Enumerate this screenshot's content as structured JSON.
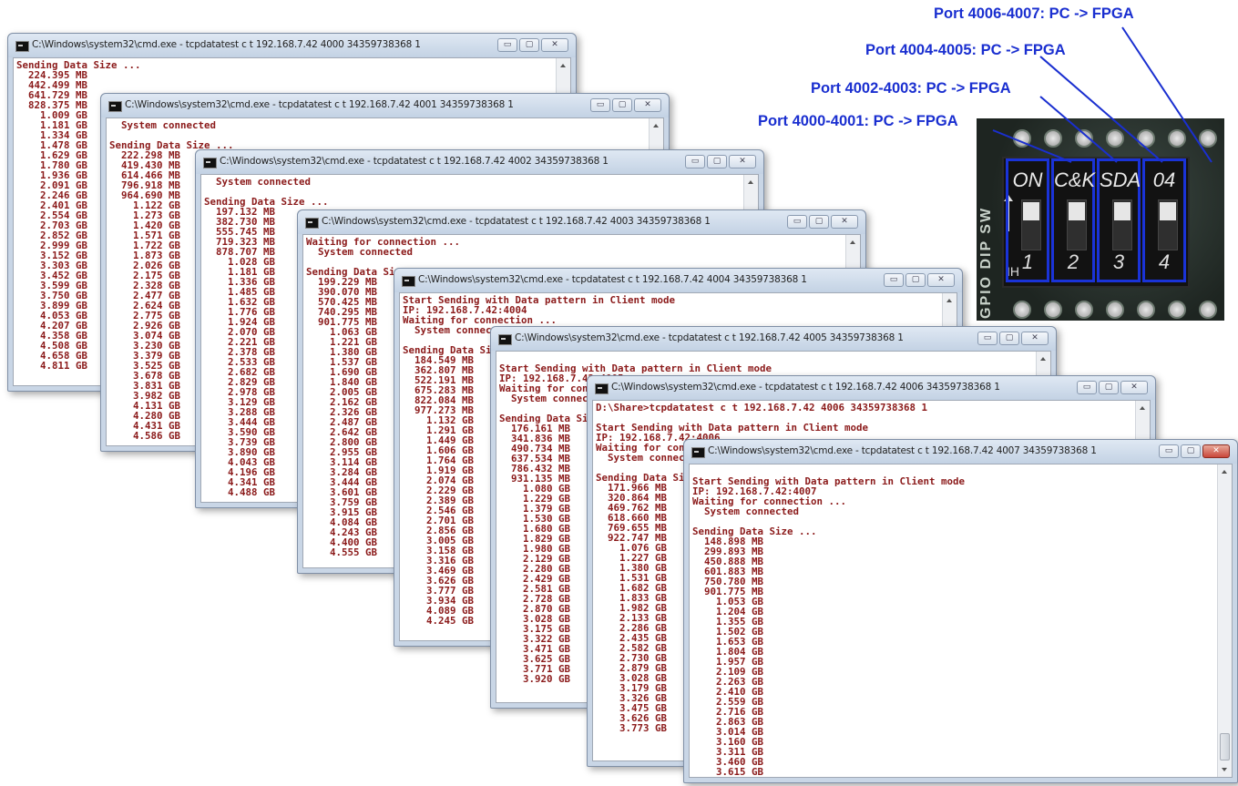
{
  "windows": [
    {
      "title": "C:\\Windows\\system32\\cmd.exe - tcpdatatest c t 192.168.7.42 4000 34359738368 1",
      "lines": [
        "Sending Data Size ...",
        "  224.395 MB",
        "  442.499 MB",
        "  641.729 MB",
        "  828.375 MB",
        "    1.009 GB",
        "    1.181 GB",
        "    1.334 GB",
        "    1.478 GB",
        "    1.629 GB",
        "    1.780 GB",
        "    1.936 GB",
        "    2.091 GB",
        "    2.246 GB",
        "    2.401 GB",
        "    2.554 GB",
        "    2.703 GB",
        "    2.852 GB",
        "    2.999 GB",
        "    3.152 GB",
        "    3.303 GB",
        "    3.452 GB",
        "    3.599 GB",
        "    3.750 GB",
        "    3.899 GB",
        "    4.053 GB",
        "    4.207 GB",
        "    4.358 GB",
        "    4.508 GB",
        "    4.658 GB",
        "    4.811 GB"
      ]
    },
    {
      "title": "C:\\Windows\\system32\\cmd.exe - tcpdatatest c t 192.168.7.42 4001 34359738368 1",
      "lines": [
        "  System connected",
        "",
        "Sending Data Size ...",
        "  222.298 MB",
        "  419.430 MB",
        "  614.466 MB",
        "  796.918 MB",
        "  964.690 MB",
        "    1.122 GB",
        "    1.273 GB",
        "    1.420 GB",
        "    1.571 GB",
        "    1.722 GB",
        "    1.873 GB",
        "    2.026 GB",
        "    2.175 GB",
        "    2.328 GB",
        "    2.477 GB",
        "    2.624 GB",
        "    2.775 GB",
        "    2.926 GB",
        "    3.074 GB",
        "    3.230 GB",
        "    3.379 GB",
        "    3.525 GB",
        "    3.678 GB",
        "    3.831 GB",
        "    3.982 GB",
        "    4.131 GB",
        "    4.280 GB",
        "    4.431 GB",
        "    4.586 GB"
      ]
    },
    {
      "title": "C:\\Windows\\system32\\cmd.exe - tcpdatatest c t 192.168.7.42 4002 34359738368 1",
      "lines": [
        "  System connected",
        "",
        "Sending Data Size ...",
        "  197.132 MB",
        "  382.730 MB",
        "  555.745 MB",
        "  719.323 MB",
        "  878.707 MB",
        "    1.028 GB",
        "    1.181 GB",
        "    1.336 GB",
        "    1.485 GB",
        "    1.632 GB",
        "    1.776 GB",
        "    1.924 GB",
        "    2.070 GB",
        "    2.221 GB",
        "    2.378 GB",
        "    2.533 GB",
        "    2.682 GB",
        "    2.829 GB",
        "    2.978 GB",
        "    3.129 GB",
        "    3.288 GB",
        "    3.444 GB",
        "    3.590 GB",
        "    3.739 GB",
        "    3.890 GB",
        "    4.043 GB",
        "    4.196 GB",
        "    4.341 GB",
        "    4.488 GB"
      ]
    },
    {
      "title": "C:\\Windows\\system32\\cmd.exe - tcpdatatest c t 192.168.7.42 4003 34359738368 1",
      "lines": [
        "Waiting for connection ...",
        "  System connected",
        "",
        "Sending Data Size ...",
        "  199.229 MB",
        "  390.070 MB",
        "  570.425 MB",
        "  740.295 MB",
        "  901.775 MB",
        "    1.063 GB",
        "    1.221 GB",
        "    1.380 GB",
        "    1.537 GB",
        "    1.690 GB",
        "    1.840 GB",
        "    2.005 GB",
        "    2.162 GB",
        "    2.326 GB",
        "    2.487 GB",
        "    2.642 GB",
        "    2.800 GB",
        "    2.955 GB",
        "    3.114 GB",
        "    3.284 GB",
        "    3.444 GB",
        "    3.601 GB",
        "    3.759 GB",
        "    3.915 GB",
        "    4.084 GB",
        "    4.243 GB",
        "    4.400 GB",
        "    4.555 GB"
      ]
    },
    {
      "title": "C:\\Windows\\system32\\cmd.exe - tcpdatatest c t 192.168.7.42 4004 34359738368 1",
      "lines": [
        "Start Sending with Data pattern in Client mode",
        "IP: 192.168.7.42:4004",
        "Waiting for connection ...",
        "  System connected",
        "",
        "Sending Data Size ...",
        "  184.549 MB",
        "  362.807 MB",
        "  522.191 MB",
        "  675.283 MB",
        "  822.084 MB",
        "  977.273 MB",
        "    1.132 GB",
        "    1.291 GB",
        "    1.449 GB",
        "    1.606 GB",
        "    1.764 GB",
        "    1.919 GB",
        "    2.074 GB",
        "    2.229 GB",
        "    2.389 GB",
        "    2.546 GB",
        "    2.701 GB",
        "    2.856 GB",
        "    3.005 GB",
        "    3.158 GB",
        "    3.316 GB",
        "    3.469 GB",
        "    3.626 GB",
        "    3.777 GB",
        "    3.934 GB",
        "    4.089 GB",
        "    4.245 GB"
      ]
    },
    {
      "title": "C:\\Windows\\system32\\cmd.exe - tcpdatatest c t 192.168.7.42 4005 34359738368 1",
      "lines": [
        "",
        "Start Sending with Data pattern in Client mode",
        "IP: 192.168.7.42:4005",
        "Waiting for connection ...",
        "  System connected",
        "",
        "Sending Data Size ...",
        "  176.161 MB",
        "  341.836 MB",
        "  490.734 MB",
        "  637.534 MB",
        "  786.432 MB",
        "  931.135 MB",
        "    1.080 GB",
        "    1.229 GB",
        "    1.379 GB",
        "    1.530 GB",
        "    1.680 GB",
        "    1.829 GB",
        "    1.980 GB",
        "    2.129 GB",
        "    2.280 GB",
        "    2.429 GB",
        "    2.581 GB",
        "    2.728 GB",
        "    2.870 GB",
        "    3.028 GB",
        "    3.175 GB",
        "    3.322 GB",
        "    3.471 GB",
        "    3.625 GB",
        "    3.771 GB",
        "    3.920 GB"
      ]
    },
    {
      "title": "C:\\Windows\\system32\\cmd.exe - tcpdatatest c t 192.168.7.42 4006 34359738368 1",
      "lines": [
        "D:\\Share>tcpdatatest c t 192.168.7.42 4006 34359738368 1",
        "",
        "Start Sending with Data pattern in Client mode",
        "IP: 192.168.7.42:4006",
        "Waiting for connection ...",
        "  System connected",
        "",
        "Sending Data Size ...",
        "  171.966 MB",
        "  320.864 MB",
        "  469.762 MB",
        "  618.660 MB",
        "  769.655 MB",
        "  922.747 MB",
        "    1.076 GB",
        "    1.227 GB",
        "    1.380 GB",
        "    1.531 GB",
        "    1.682 GB",
        "    1.833 GB",
        "    1.982 GB",
        "    2.133 GB",
        "    2.286 GB",
        "    2.435 GB",
        "    2.582 GB",
        "    2.730 GB",
        "    2.879 GB",
        "    3.028 GB",
        "    3.179 GB",
        "    3.326 GB",
        "    3.475 GB",
        "    3.626 GB",
        "    3.773 GB"
      ]
    },
    {
      "title": "C:\\Windows\\system32\\cmd.exe - tcpdatatest c t 192.168.7.42 4007 34359738368 1",
      "lines": [
        "",
        "Start Sending with Data pattern in Client mode",
        "IP: 192.168.7.42:4007",
        "Waiting for connection ...",
        "  System connected",
        "",
        "Sending Data Size ...",
        "  148.898 MB",
        "  299.893 MB",
        "  450.888 MB",
        "  601.883 MB",
        "  750.780 MB",
        "  901.775 MB",
        "    1.053 GB",
        "    1.204 GB",
        "    1.355 GB",
        "    1.502 GB",
        "    1.653 GB",
        "    1.804 GB",
        "    1.957 GB",
        "    2.109 GB",
        "    2.263 GB",
        "    2.410 GB",
        "    2.559 GB",
        "    2.716 GB",
        "    2.863 GB",
        "    3.014 GB",
        "    3.160 GB",
        "    3.311 GB",
        "    3.460 GB",
        "    3.615 GB"
      ]
    }
  ],
  "window_controls": {
    "minimize": "▭",
    "maximize": "▢",
    "close": "✕"
  },
  "port_labels": [
    "Port 4006-4007: PC -> FPGA",
    "Port 4004-4005: PC -> FPGA",
    "Port 4002-4003: PC -> FPGA",
    "Port 4000-4001: PC -> FPGA"
  ],
  "photo": {
    "side_label": "GPIO DIP SW",
    "switch_top": [
      "ON",
      "C&K",
      "SDA",
      "04"
    ],
    "switch_numbers": [
      "1",
      "2",
      "3",
      "4"
    ],
    "ih_label": "IH"
  },
  "colors": {
    "console_text": "#8b1a1a",
    "label_blue": "#1a2fd0"
  }
}
